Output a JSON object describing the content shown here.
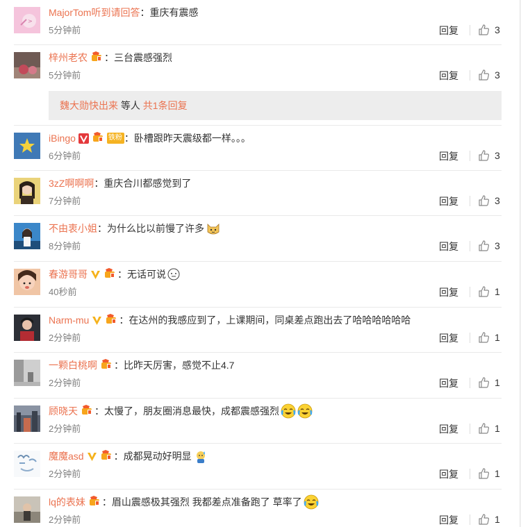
{
  "comments": [
    {
      "user": "MajorTom听到请回答",
      "text": "重庆有震感",
      "time": "5分钟前",
      "likes": "3",
      "badges": [],
      "emoji": []
    },
    {
      "user": "梓州老农",
      "text": "三台震感强烈",
      "time": "5分钟前",
      "likes": "3",
      "badges": [
        "member"
      ],
      "emoji": []
    },
    {
      "user": "iBingo",
      "text": "卧槽跟昨天震级都一样。。。",
      "time": "6分钟前",
      "likes": "3",
      "badges": [
        "v-red",
        "member",
        "fans"
      ],
      "emoji": []
    },
    {
      "user": "3zZ啊啊啊",
      "text": "重庆合川都感觉到了",
      "time": "7分钟前",
      "likes": "3",
      "badges": [],
      "emoji": []
    },
    {
      "user": "不由衷小姐",
      "text": "为什么比以前慢了许多",
      "time": "8分钟前",
      "likes": "3",
      "badges": [],
      "emoji": [
        "cat"
      ]
    },
    {
      "user": "春游哥哥",
      "text": "无话可说",
      "time": "40秒前",
      "likes": "1",
      "badges": [
        "v-yellow",
        "member"
      ],
      "emoji": [
        "speechless"
      ]
    },
    {
      "user": "Narm-mu",
      "text": "在达州的我感应到了，上课期间，同桌差点跑出去了哈哈哈哈哈哈",
      "time": "2分钟前",
      "likes": "1",
      "badges": [
        "v-yellow",
        "member"
      ],
      "emoji": []
    },
    {
      "user": "一颗白桃啊",
      "text": "比昨天厉害，感觉不止4.7",
      "time": "2分钟前",
      "likes": "1",
      "badges": [
        "member"
      ],
      "emoji": []
    },
    {
      "user": "顾晓天",
      "text": "太慢了，朋友圈消息最快，成都震感强烈",
      "time": "2分钟前",
      "likes": "1",
      "badges": [
        "member"
      ],
      "emoji": [
        "laugh-cry",
        "laugh-cry"
      ]
    },
    {
      "user": "魔魔asd",
      "text": "成都晃动好明显",
      "time": "2分钟前",
      "likes": "1",
      "badges": [
        "v-yellow",
        "member"
      ],
      "emoji": [
        "sweat"
      ]
    },
    {
      "user": "lq的表妹",
      "text": "眉山震感极其强烈 我都差点准备跑了 草率了",
      "time": "2分钟前",
      "likes": "1",
      "badges": [
        "member"
      ],
      "emoji": [
        "laugh-cry"
      ]
    }
  ],
  "labels": {
    "reply": "回复",
    "colon": "：",
    "fans_badge": "铁粉"
  },
  "subreply": {
    "user": "魏大勋快出来",
    "mid": " 等人 ",
    "count": "共1条回复"
  },
  "colors": {
    "username": "#eb7350",
    "text": "#333333",
    "meta": "#808080",
    "subreply_bg": "#ededed"
  }
}
